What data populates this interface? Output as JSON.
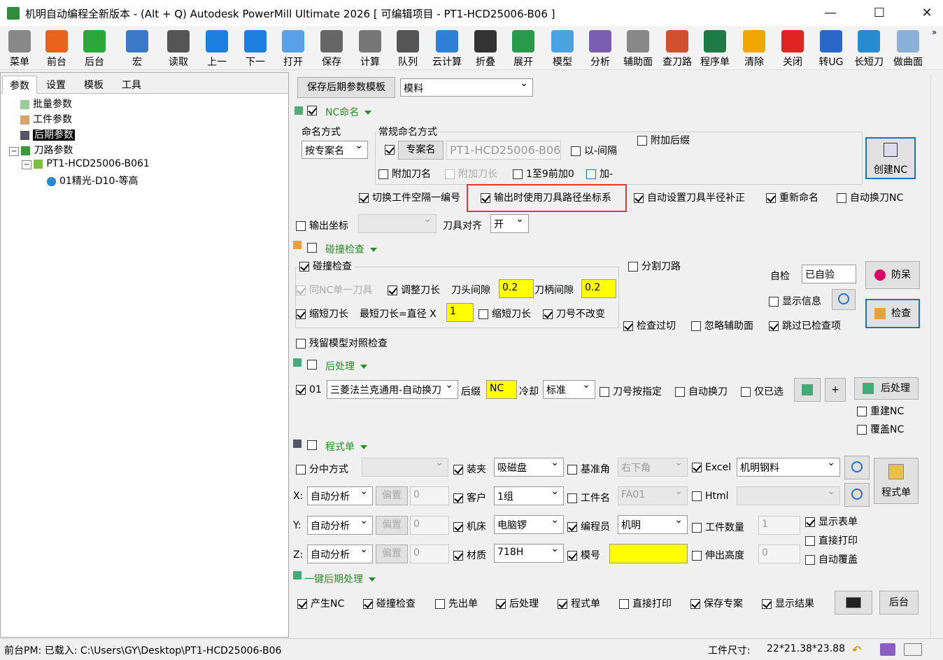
{
  "title": "机明自动编程全新版本 - (Alt + Q) Autodesk PowerMill Ultimate 2026   [ 可编辑项目 - PT1-HCD25006-B06 ]",
  "window": {
    "minimize": "—",
    "maximize": "☐",
    "close": "✕"
  },
  "toolbar": [
    {
      "label": "菜单",
      "icon": "gear-icon",
      "color": "#888888"
    },
    {
      "label": "前台",
      "icon": "powermill-icon",
      "color": "#e8641e"
    },
    {
      "label": "后台",
      "icon": "plus-icon",
      "color": "#2aa839"
    },
    {
      "label": "宏",
      "icon": "macro-icon",
      "color": "#3b78c6"
    },
    {
      "label": "读取",
      "icon": "sliders-icon",
      "color": "#555555"
    },
    {
      "label": "上一",
      "icon": "skip-back-icon",
      "color": "#1e7fe0"
    },
    {
      "label": "下一",
      "icon": "skip-forward-icon",
      "color": "#1e7fe0"
    },
    {
      "label": "打开",
      "icon": "folder-icon",
      "color": "#5aa0e8"
    },
    {
      "label": "保存",
      "icon": "floppy-icon",
      "color": "#666666"
    },
    {
      "label": "计算",
      "icon": "calculator-icon",
      "color": "#777777"
    },
    {
      "label": "队列",
      "icon": "terminal-icon",
      "color": "#555555"
    },
    {
      "label": "云计算",
      "icon": "cloud-icon",
      "color": "#2f7fd6"
    },
    {
      "label": "折叠",
      "icon": "collapse-icon",
      "color": "#333333"
    },
    {
      "label": "展开",
      "icon": "expand-icon",
      "color": "#2a9a4a"
    },
    {
      "label": "模型",
      "icon": "cube-icon",
      "color": "#4aa3e0"
    },
    {
      "label": "分析",
      "icon": "analyze-icon",
      "color": "#7a5fb0"
    },
    {
      "label": "辅助面",
      "icon": "aux-surface-icon",
      "color": "#888888"
    },
    {
      "label": "查刀路",
      "icon": "tools-icon",
      "color": "#d05030"
    },
    {
      "label": "程序单",
      "icon": "excel-icon",
      "color": "#1e7b45"
    },
    {
      "label": "清除",
      "icon": "warning-icon",
      "color": "#f0a800"
    },
    {
      "label": "关闭",
      "icon": "close-circle-icon",
      "color": "#e02424"
    },
    {
      "label": "转UG",
      "icon": "nx-icon",
      "color": "#2a66c8"
    },
    {
      "label": "长短刀",
      "icon": "scissors-icon",
      "color": "#2a8ad0"
    },
    {
      "label": "做曲面",
      "icon": "surface-icon",
      "color": "#8ab0d8"
    }
  ],
  "left": {
    "tabs": [
      "参数",
      "设置",
      "模板",
      "工具"
    ],
    "tree": {
      "batch": "批量参数",
      "work": "工件参数",
      "post": "后期参数",
      "paths": "刀路参数",
      "project": "PT1-HCD25006-B061",
      "toolpath": "01精光-D10-等高"
    }
  },
  "top": {
    "save_template": "保存后期参数模板",
    "template_select": "模料"
  },
  "nc": {
    "section": "NC命名",
    "naming_mode_label": "命名方式",
    "naming_mode": "按专案名",
    "normal_naming_label": "常规命名方式",
    "project_name_btn": "专案名",
    "project_name_value": "PT1-HCD25006-B06",
    "dash_sep": "以-间隔",
    "add_suffix": "附加后缀",
    "add_tool_name": "附加刀名",
    "add_tool_len": "附加刀长",
    "pad_zero": "1至9前加0",
    "add_dash": "加-",
    "create_nc": "创建NC",
    "switch_ws": "切换工件空隔一编号",
    "use_tp_coord": "输出时使用刀具路径坐标系",
    "auto_radius": "自动设置刀具半径补正",
    "rename": "重新命名",
    "auto_tool_nc": "自动换刀NC",
    "output_coord": "输出坐标",
    "tool_align": "刀具对齐",
    "tool_align_value": "开"
  },
  "collision": {
    "section": "碰撞检查",
    "check": "碰撞检查",
    "same_nc_tool": "同NC单一刀具",
    "adjust_len": "调整刀长",
    "head_gap": "刀头间隙",
    "head_gap_value": "0.2",
    "holder_gap": "刀柄间隙",
    "holder_gap_value": "0.2",
    "shorten": "缩短刀长",
    "min_len": "最短刀长=直径 X",
    "min_len_value": "1",
    "shorten2": "缩短刀长",
    "keep_number": "刀号不改变",
    "split_path": "分割刀路",
    "self_check": "自检",
    "self_check_value": "已自验",
    "show_info": "显示信息",
    "anti_dull": "防呆",
    "inspect": "检查",
    "check_overcut": "检查过切",
    "ignore_aux": "忽略辅助面",
    "skip_checked": "跳过已检查项",
    "residual": "残留模型对照检查"
  },
  "post": {
    "section": "后处理",
    "index": "01",
    "processor": "三菱法兰克通用-自动换刀",
    "suffix_label": "后缀",
    "suffix_value": "NC",
    "coolant_label": "冷却",
    "coolant_value": "标准",
    "tool_specify": "刀号按指定",
    "auto_change": "自动换刀",
    "only_selected": "仅已选",
    "plus": "+",
    "post_btn": "后处理",
    "rebuild_nc": "重建NC",
    "overwrite_nc": "覆盖NC"
  },
  "sheet": {
    "section": "程式单",
    "split_mode": "分中方式",
    "clamp": "装夹",
    "clamp_value": "吸磁盘",
    "ref_corner": "基准角",
    "ref_corner_value": "右下角",
    "excel": "Excel",
    "excel_value": "机明钢料",
    "x_label": "X:",
    "y_label": "Y:",
    "z_label": "Z:",
    "auto_analyze": "自动分析",
    "offset_btn": "偏置",
    "offset_value": "0",
    "customer": "客户",
    "customer_value": "1组",
    "workpiece_name": "工件名",
    "workpiece_name_value": "FA01",
    "html": "Html",
    "machine": "机床",
    "machine_value": "电脑锣",
    "programmer": "编程员",
    "programmer_value": "机明",
    "work_count": "工件数量",
    "work_count_value": "1",
    "material": "材质",
    "material_value": "718H",
    "mold_no": "模号",
    "mold_no_value": "",
    "ext_height": "伸出高度",
    "ext_height_value": "0",
    "show_sheet": "显示表单",
    "direct_print": "直接打印",
    "auto_cover": "自动覆盖",
    "sheet_btn": "程式单"
  },
  "onekey": {
    "section": "一键后期处理",
    "gen_nc": "产生NC",
    "collision": "碰撞检查",
    "first_sheet": "先出单",
    "post": "后处理",
    "sheet": "程式单",
    "direct_print": "直接打印",
    "save_project": "保存专案",
    "show_result": "显示结果",
    "background": "后台"
  },
  "status": {
    "left": "前台PM: 已载入: C:\\Users\\GY\\Desktop\\PT1-HCD25006-B06",
    "size_label": "工件尺寸:",
    "size_value": "22*21.38*23.88"
  }
}
